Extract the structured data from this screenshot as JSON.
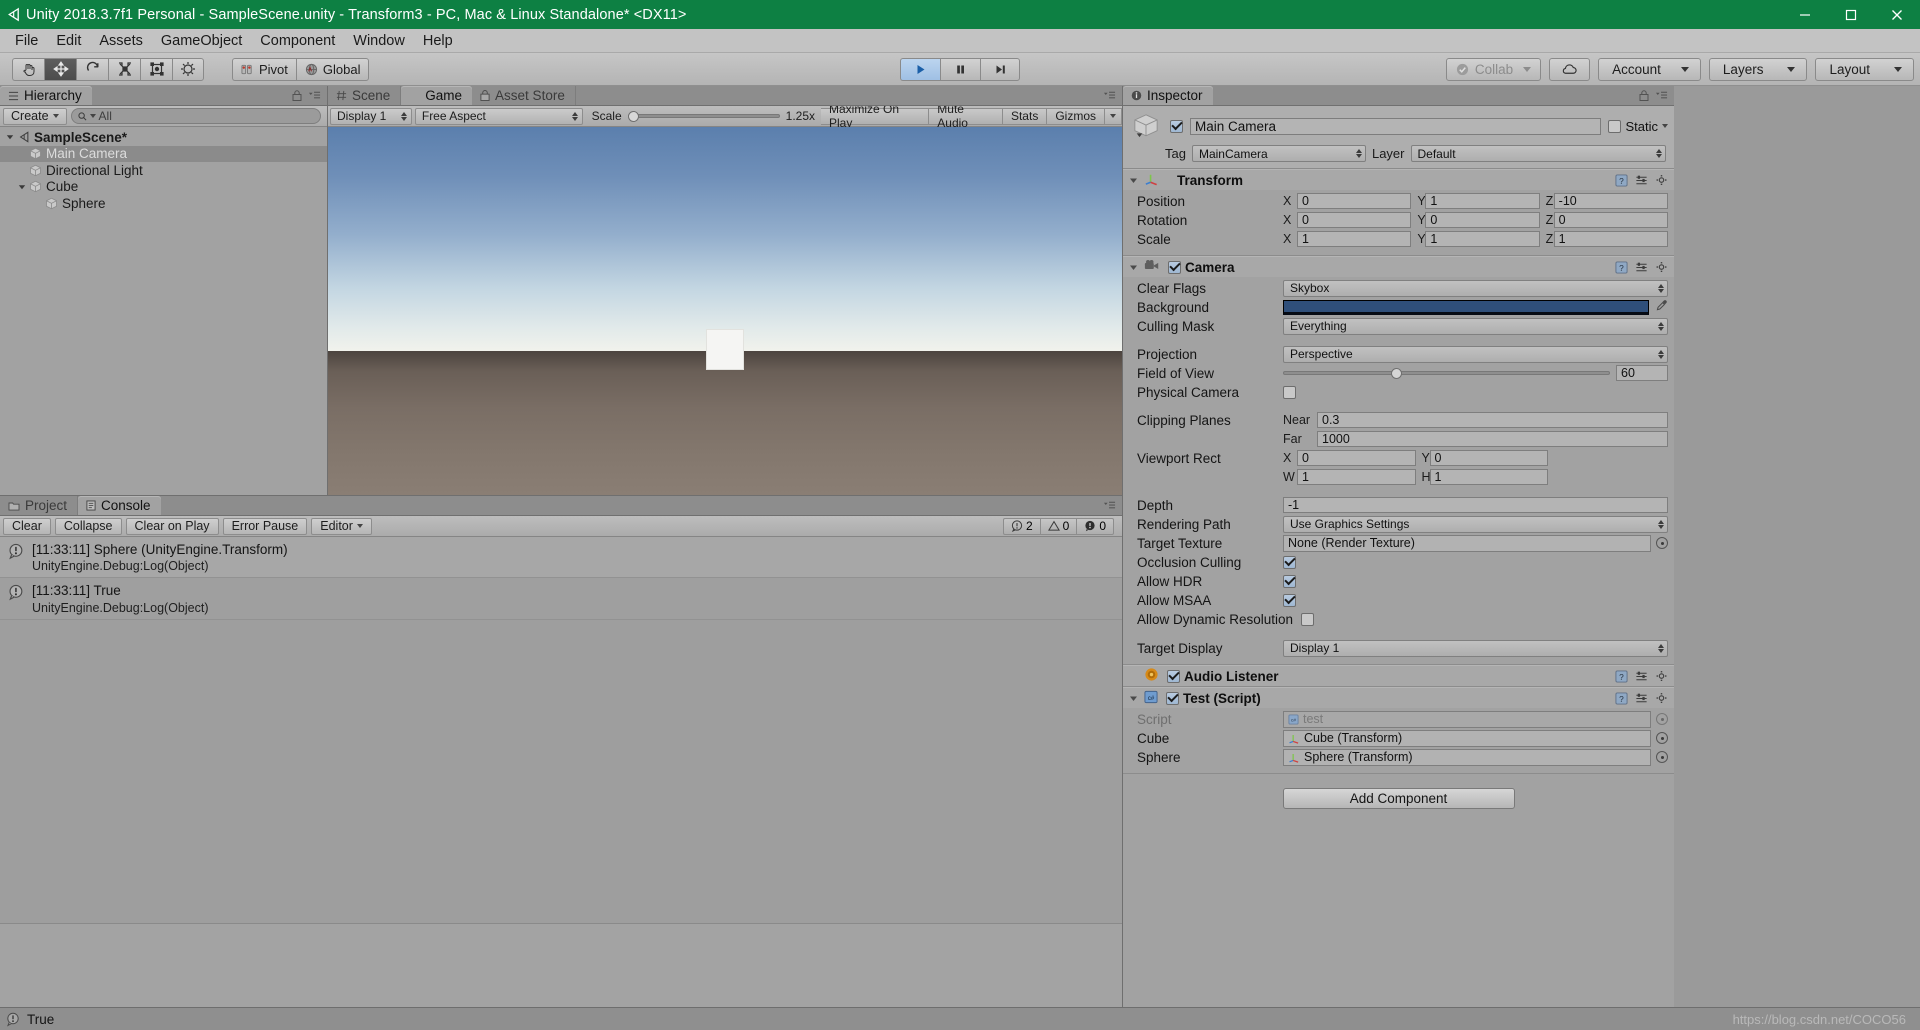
{
  "titlebar": {
    "title": "Unity 2018.3.7f1 Personal - SampleScene.unity - Transform3 - PC, Mac & Linux Standalone* <DX11>",
    "minimize": "minimize-icon",
    "maximize": "maximize-icon",
    "close": "close-icon"
  },
  "menubar": {
    "items": [
      "File",
      "Edit",
      "Assets",
      "GameObject",
      "Component",
      "Window",
      "Help"
    ]
  },
  "toolbar": {
    "tools": [
      "hand-tool",
      "move-tool",
      "rotate-tool",
      "scale-tool",
      "rect-tool",
      "transform-tool"
    ],
    "pivot": "Pivot",
    "global": "Global",
    "play": "play-button",
    "pause": "pause-button",
    "step": "step-button",
    "collab": "Collab",
    "cloud": "cloud-icon",
    "account": "Account",
    "layers": "Layers",
    "layout": "Layout"
  },
  "hierarchy": {
    "tab": "Hierarchy",
    "create": "Create",
    "search_placeholder": "All",
    "tree": [
      {
        "label": "SampleScene*",
        "depth": 0,
        "icon": "unity-scene-icon",
        "expandable": true,
        "selected": false,
        "bold": true
      },
      {
        "label": "Main Camera",
        "depth": 1,
        "icon": "gameobject-icon",
        "expandable": false,
        "selected": true,
        "bold": false
      },
      {
        "label": "Directional Light",
        "depth": 1,
        "icon": "gameobject-icon",
        "expandable": false,
        "selected": false,
        "bold": false
      },
      {
        "label": "Cube",
        "depth": 1,
        "icon": "gameobject-icon",
        "expandable": true,
        "selected": false,
        "bold": false
      },
      {
        "label": "Sphere",
        "depth": 2,
        "icon": "gameobject-icon",
        "expandable": false,
        "selected": false,
        "bold": false
      }
    ]
  },
  "viewtabs": [
    {
      "label": "Scene",
      "icon": "scene-icon",
      "active": false
    },
    {
      "label": "Game",
      "icon": "game-icon",
      "active": true
    },
    {
      "label": "Asset Store",
      "icon": "store-icon",
      "active": false
    }
  ],
  "gameview": {
    "display": "Display 1",
    "aspect": "Free Aspect",
    "scale_label": "Scale",
    "scale_value": "1.25x",
    "buttons": [
      "Maximize On Play",
      "Mute Audio",
      "Stats",
      "Gizmos"
    ]
  },
  "console": {
    "tabs": [
      {
        "label": "Project",
        "icon": "folder-icon",
        "active": false
      },
      {
        "label": "Console",
        "icon": "console-icon",
        "active": true
      }
    ],
    "buttons": [
      "Clear",
      "Collapse",
      "Clear on Play",
      "Error Pause",
      "Editor"
    ],
    "counts": {
      "log": "2",
      "warning": "0",
      "error": "0"
    },
    "entries": [
      {
        "line1": "[11:33:11] Sphere (UnityEngine.Transform)",
        "line2": "UnityEngine.Debug:Log(Object)",
        "icon": "info-icon"
      },
      {
        "line1": "[11:33:11] True",
        "line2": "UnityEngine.Debug:Log(Object)",
        "icon": "info-icon"
      }
    ]
  },
  "inspector": {
    "tab": "Inspector",
    "object_name": "Main Camera",
    "object_enabled": true,
    "static_label": "Static",
    "tag_label": "Tag",
    "tag_value": "MainCamera",
    "layer_label": "Layer",
    "layer_value": "Default",
    "components": [
      {
        "title": "Transform",
        "icon": "transform-icon",
        "has_checkbox": false,
        "rows": [
          {
            "type": "vector3",
            "name": "Position",
            "x": "0",
            "y": "1",
            "z": "-10"
          },
          {
            "type": "vector3",
            "name": "Rotation",
            "x": "0",
            "y": "0",
            "z": "0"
          },
          {
            "type": "vector3",
            "name": "Scale",
            "x": "1",
            "y": "1",
            "z": "1"
          }
        ]
      },
      {
        "title": "Camera",
        "icon": "camera-icon",
        "has_checkbox": true,
        "enabled": true,
        "rows": [
          {
            "type": "dropdown",
            "name": "Clear Flags",
            "value": "Skybox"
          },
          {
            "type": "color",
            "name": "Background",
            "value": "#2f4f7a"
          },
          {
            "type": "dropdown",
            "name": "Culling Mask",
            "value": "Everything"
          },
          {
            "type": "spacer"
          },
          {
            "type": "dropdown",
            "name": "Projection",
            "value": "Perspective"
          },
          {
            "type": "slider",
            "name": "Field of View",
            "value": "60",
            "percent": 33
          },
          {
            "type": "checkbox",
            "name": "Physical Camera",
            "checked": false
          },
          {
            "type": "spacer"
          },
          {
            "type": "pair",
            "name": "Clipping Planes",
            "sub1": "Near",
            "val1": "0.3"
          },
          {
            "type": "pair",
            "name": "",
            "sub1": "Far",
            "val1": "1000"
          },
          {
            "type": "rect2",
            "name": "Viewport Rect",
            "a": "X",
            "av": "0",
            "b": "Y",
            "bv": "0"
          },
          {
            "type": "rect2",
            "name": "",
            "a": "W",
            "av": "1",
            "b": "H",
            "bv": "1"
          },
          {
            "type": "spacer"
          },
          {
            "type": "text",
            "name": "Depth",
            "value": "-1"
          },
          {
            "type": "dropdown",
            "name": "Rendering Path",
            "value": "Use Graphics Settings"
          },
          {
            "type": "object",
            "name": "Target Texture",
            "value": "None (Render Texture)"
          },
          {
            "type": "checkbox",
            "name": "Occlusion Culling",
            "checked": true
          },
          {
            "type": "checkbox",
            "name": "Allow HDR",
            "checked": true
          },
          {
            "type": "checkbox",
            "name": "Allow MSAA",
            "checked": true
          },
          {
            "type": "checkbox",
            "name": "Allow Dynamic Resolution",
            "checked": false
          },
          {
            "type": "spacer"
          },
          {
            "type": "dropdown",
            "name": "Target Display",
            "value": "Display 1"
          }
        ]
      },
      {
        "title": "Audio Listener",
        "icon": "audio-listener-icon",
        "has_checkbox": true,
        "enabled": true,
        "collapsed": true,
        "rows": []
      },
      {
        "title": "Test (Script)",
        "icon": "script-icon",
        "has_checkbox": true,
        "enabled": true,
        "rows": [
          {
            "type": "object",
            "name": "Script",
            "value": "test",
            "disabled": true,
            "icon": "script-icon"
          },
          {
            "type": "object",
            "name": "Cube",
            "value": "Cube (Transform)",
            "icon": "transform-icon"
          },
          {
            "type": "object",
            "name": "Sphere",
            "value": "Sphere (Transform)",
            "icon": "transform-icon"
          }
        ]
      }
    ],
    "add_component": "Add Component"
  },
  "statusbar": {
    "text": "True",
    "watermark": "https://blog.csdn.net/COCO56"
  },
  "colors": {
    "title_green": "#0d8043",
    "panel_gray": "#a2a2a2",
    "selection": "#8b8b8b",
    "background_color": "#2f4f7a"
  }
}
